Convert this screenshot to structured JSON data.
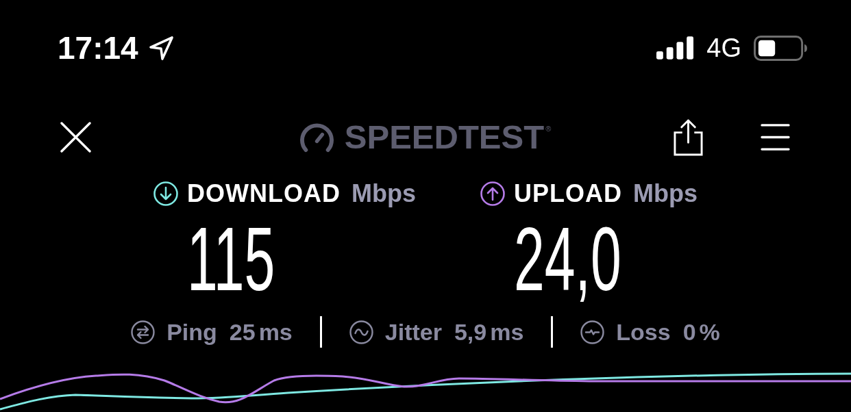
{
  "status_bar": {
    "time": "17:14",
    "network": "4G"
  },
  "header": {
    "logo": {
      "text": "SPEEDTEST",
      "mark": "®"
    }
  },
  "results": [
    {
      "kind": "download",
      "label": "DOWNLOAD",
      "unit": "Mbps",
      "value": "115",
      "color": "#7ee8e2"
    },
    {
      "kind": "upload",
      "label": "UPLOAD",
      "unit": "Mbps",
      "value": "24,0",
      "color": "#b57be8"
    }
  ],
  "stats": [
    {
      "kind": "ping",
      "label": "Ping",
      "value": "25",
      "unit": "ms"
    },
    {
      "kind": "jitter",
      "label": "Jitter",
      "value": "5,9",
      "unit": "ms"
    },
    {
      "kind": "loss",
      "label": "Loss",
      "value": "0",
      "unit": "%"
    }
  ]
}
